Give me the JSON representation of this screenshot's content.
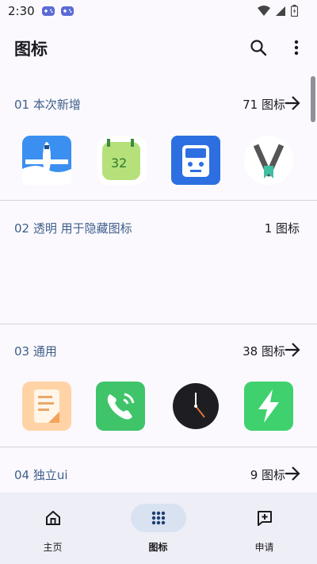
{
  "status_bar": {
    "time": "2:30"
  },
  "header": {
    "title": "图标"
  },
  "sections": [
    {
      "title": "01 本次新增",
      "count": "71 图标",
      "icons": [
        "airplane-icon",
        "calendar-icon",
        "bus-icon",
        "v-bookmark-icon"
      ]
    },
    {
      "title": "02 透明 用于隐藏图标",
      "count": "1 图标",
      "icons": []
    },
    {
      "title": "03 通用",
      "count": "38 图标",
      "icons": [
        "notes-icon",
        "phone-icon",
        "clock-icon",
        "bolt-icon"
      ]
    },
    {
      "title": "04 独立ui",
      "count": "9 图标",
      "icons": []
    }
  ],
  "nav": [
    {
      "label": "主页",
      "icon": "home-icon",
      "active": false
    },
    {
      "label": "图标",
      "icon": "grid-icon",
      "active": true
    },
    {
      "label": "申请",
      "icon": "add-comment-icon",
      "active": false
    }
  ],
  "colors": {
    "accent": "#3e5f8a",
    "nav_bg": "#eeeef6",
    "active_pill": "#d9e2f1"
  }
}
